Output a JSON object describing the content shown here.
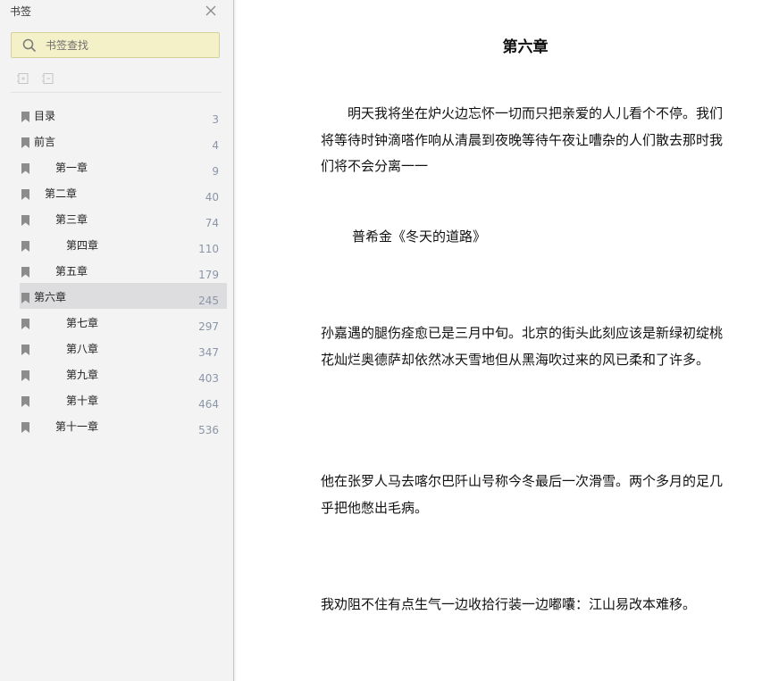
{
  "sidebar": {
    "title": "书签",
    "search_placeholder": "书签查找",
    "bookmarks": [
      {
        "label": "目录",
        "page": "3"
      },
      {
        "label": "前言",
        "page": "4"
      },
      {
        "label": "第一章",
        "page": "9"
      },
      {
        "label": "第二章",
        "page": "40"
      },
      {
        "label": "第三章",
        "page": "74"
      },
      {
        "label": "第四章",
        "page": "110"
      },
      {
        "label": "第五章",
        "page": "179"
      },
      {
        "label": "第六章",
        "page": "245"
      },
      {
        "label": "第七章",
        "page": "297"
      },
      {
        "label": "第八章",
        "page": "347"
      },
      {
        "label": "第九章",
        "page": "403"
      },
      {
        "label": "第十章",
        "page": "464"
      },
      {
        "label": "第十一章",
        "page": "536"
      }
    ],
    "active_bookmark": "第六章"
  },
  "content": {
    "chapter_title": "第六章",
    "paragraphs": [
      "明天我将坐在炉火边忘怀一切而只把亲爱的人儿看个不停。我们将等待时钟滴嗒作响从清晨到夜晚等待午夜让嘈杂的人们散去那时我们将不会分离一一",
      "普希金《冬天的道路》",
      "孙嘉遇的腿伤痊愈已是三月中旬。北京的街头此刻应该是新绿初绽桃花灿烂奥德萨却依然冰天雪地但从黑海吹过来的风已柔和了许多。",
      "他在张罗人马去喀尔巴阡山号称今冬最后一次滑雪。两个多月的足几乎把他憋出毛病。",
      "我劝阻不住有点生气一边收拾行装一边嘟囔：江山易改本难移。"
    ]
  },
  "colors": {
    "sidebar_bg": "#f3f3f3",
    "search_bg": "#f4f0c8",
    "active_item_bg": "#dddde0",
    "page_number": "#8a96a8"
  }
}
